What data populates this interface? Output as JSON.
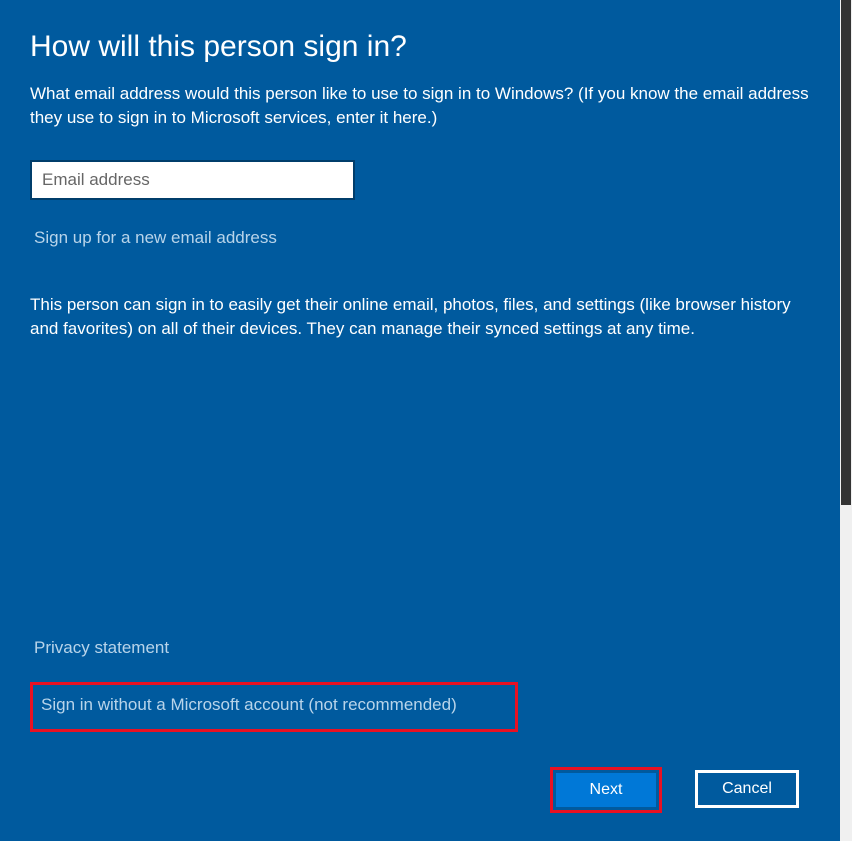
{
  "title": "How will this person sign in?",
  "description": "What email address would this person like to use to sign in to Windows? (If you know the email address they use to sign in to Microsoft services, enter it here.)",
  "email": {
    "placeholder": "Email address",
    "value": ""
  },
  "signup_link": "Sign up for a new email address",
  "info_text": "This person can sign in to easily get their online email, photos, files, and settings (like browser history and favorites) on all of their devices. They can manage their synced settings at any time.",
  "privacy_link": "Privacy statement",
  "no_account_link": "Sign in without a Microsoft account (not recommended)",
  "buttons": {
    "next": "Next",
    "cancel": "Cancel"
  }
}
